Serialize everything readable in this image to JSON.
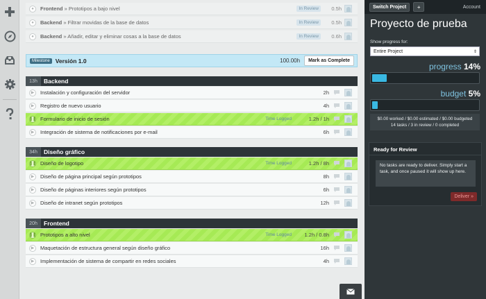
{
  "nav": {
    "icons": [
      "plus-icon",
      "compass-icon",
      "inbox-icon",
      "gear-icon",
      "help-icon"
    ]
  },
  "pending_tasks": [
    {
      "project": "Frontend",
      "sep": " » ",
      "name": "Prototipos a bajo nivel",
      "tag": "In Review",
      "hours": "0.5h"
    },
    {
      "project": "Backend",
      "sep": " » ",
      "name": "Filtrar movidas de la base de datos",
      "tag": "In Review",
      "hours": "0.5h"
    },
    {
      "project": "Backend",
      "sep": " » ",
      "name": "Añadir, editar y eliminar cosas a la base de datos",
      "tag": "In Review",
      "hours": "0.6h"
    }
  ],
  "milestone": {
    "badge": "Milestone",
    "title": "Versión 1.0",
    "hours": "100.00h",
    "button": "Mark as Complete"
  },
  "groups": [
    {
      "hours": "13h",
      "title": "Backend",
      "tasks": [
        {
          "name": "Instalación y configuración del servidor",
          "tag": "",
          "hours": "2h"
        },
        {
          "name": "Registro de nuevo usuario",
          "tag": "",
          "hours": "4h"
        },
        {
          "name": "Formulario de inicio de sesión",
          "tag": "Time Logged",
          "hours": "1.2h / 1h"
        },
        {
          "name": "Integración de sistema de notificaciones por e-mail",
          "tag": "",
          "hours": "6h"
        }
      ]
    },
    {
      "hours": "34h",
      "title": "Diseño gráfico",
      "tasks": [
        {
          "name": "Diseño de logotipo",
          "tag": "Time Logged",
          "hours": "1.2h / 8h"
        },
        {
          "name": "Diseño de página principal según prototipos",
          "tag": "",
          "hours": "8h"
        },
        {
          "name": "Diseño de páginas interiores según prototipos",
          "tag": "",
          "hours": "6h"
        },
        {
          "name": "Diseño de intranet según prototipos",
          "tag": "",
          "hours": "12h"
        }
      ]
    },
    {
      "hours": "20h",
      "title": "Frontend",
      "tasks": [
        {
          "name": "Prototipos a alto nivel",
          "tag": "Time Logged",
          "hours": "1.2h / 0.8h"
        },
        {
          "name": "Maquetación de estructura general según diseño gráfico",
          "tag": "",
          "hours": "16h"
        },
        {
          "name": "Implementación de sistema de compartir en redes sociales",
          "tag": "",
          "hours": "4h"
        }
      ]
    }
  ],
  "sidebar": {
    "switch_project": "Switch Project",
    "plus": "+",
    "account": "Account",
    "project_title": "Proyecto de prueba",
    "show_progress_label": "Show progress for:",
    "progress_select": "Entire Project",
    "progress_label": "progress",
    "progress_value": "14%",
    "progress_fraction": 0.14,
    "budget_label": "budget",
    "budget_value": "5%",
    "budget_fraction": 0.05,
    "stats_line1": "$0.00 worked / $0.00 estimated / $0.00 budgeted",
    "stats_line2": "14 tasks / 3 in review / 0 completed",
    "review_heading": "Ready for Review",
    "review_message": "No tasks are ready to deliver. Simply start a task, and once paused it will show up here.",
    "deliver_button": "Deliver »"
  },
  "colors": {
    "sidebar_bg": "#2f3639",
    "active_task": "#a6ea55",
    "milestone_bg": "#c3e8f6",
    "progress_fill": "#39b8e2",
    "accent_text": "#7fc3e0",
    "deliver_bg": "#7e2a2a"
  }
}
